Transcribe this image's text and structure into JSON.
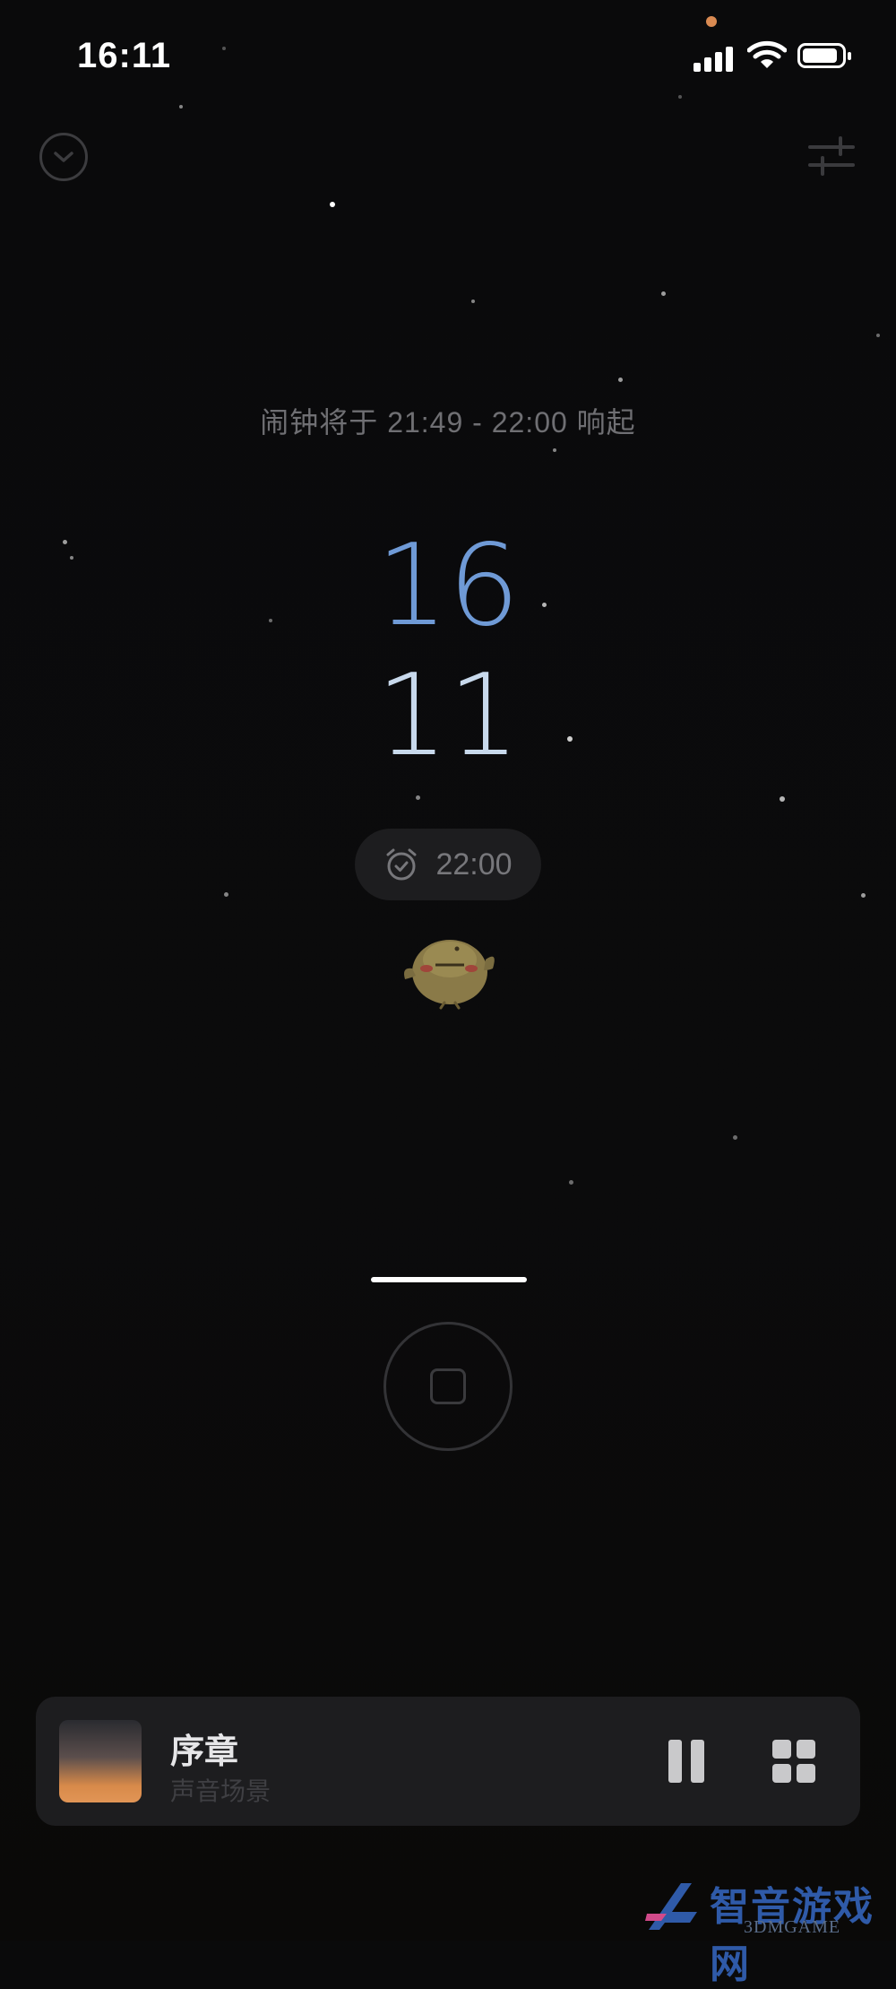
{
  "status_bar": {
    "time": "16:11",
    "recording_dot_color": "#d98a52"
  },
  "header": {
    "collapse_icon": "chevron-down-circle-icon",
    "settings_icon": "sliders-icon"
  },
  "alarm_note": "闹钟将于 21:49 - 22:00 响起",
  "clock": {
    "hour": "16",
    "minute": "11",
    "hour_color": "#6f9ad6",
    "minute_color": "#c8d9ec"
  },
  "alarm_pill": {
    "icon": "alarm-clock-icon",
    "time": "22:00"
  },
  "mascot": {
    "icon": "yellow-bird-mascot"
  },
  "stop_button": {
    "icon": "stop-square-icon"
  },
  "player": {
    "title": "序章",
    "subtitle": "声音场景",
    "play_state_icon": "pause-icon",
    "scenes_icon": "grid-icon"
  },
  "watermark": {
    "text": "智音游戏网",
    "sub": "3DMGAME"
  }
}
